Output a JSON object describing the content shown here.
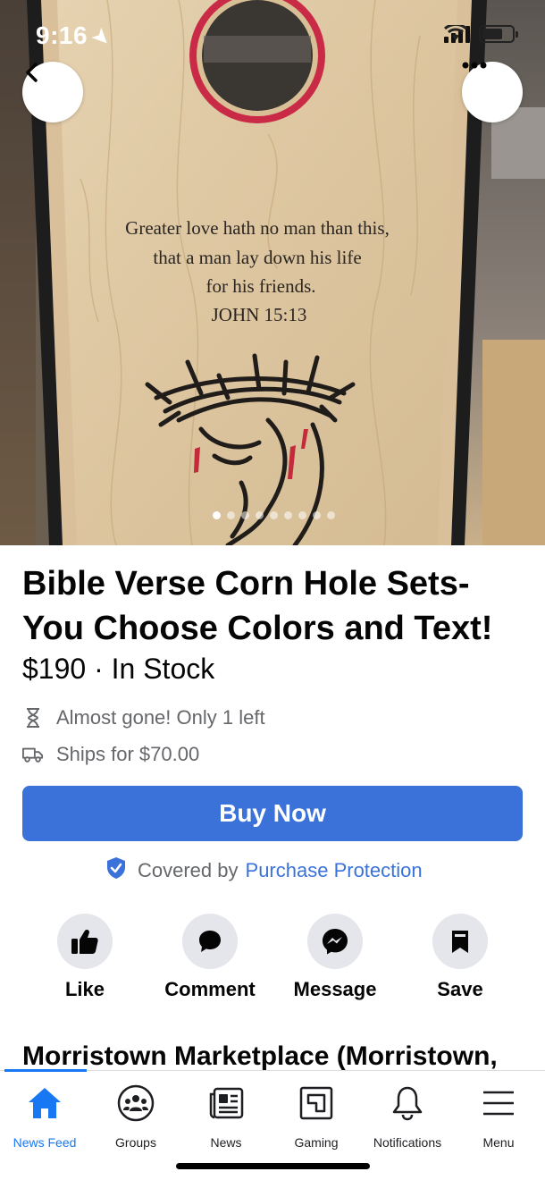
{
  "status_bar": {
    "time": "9:16",
    "icons": [
      "location-arrow-icon",
      "cellular-signal-icon",
      "wifi-icon",
      "battery-icon"
    ]
  },
  "photo": {
    "verse_lines": [
      "Greater love hath no man than this,",
      "that a man lay down his life",
      "for his friends.",
      "JOHN 15:13"
    ],
    "page_count": 9,
    "current_page": 1
  },
  "nav": {
    "back_icon": "chevron-left-icon",
    "more_icon": "more-horizontal-icon"
  },
  "listing": {
    "title_line1": "Bible Verse Corn Hole Sets-",
    "title_line2": "You Choose Colors and Text!",
    "price_line": "$190 · In Stock",
    "availability": "Almost gone! Only 1 left",
    "shipping": "Ships for $70.00"
  },
  "buy_button": {
    "label": "Buy Now"
  },
  "protection": {
    "prefix": "Covered by",
    "link": "Purchase Protection"
  },
  "actions": [
    {
      "label": "Like",
      "icon": "thumbs-up-icon"
    },
    {
      "label": "Comment",
      "icon": "comment-icon"
    },
    {
      "label": "Message",
      "icon": "messenger-icon"
    },
    {
      "label": "Save",
      "icon": "bookmark-icon"
    }
  ],
  "seller": {
    "name": "Morristown Marketplace (Morristown,"
  },
  "tabs": [
    {
      "label": "News Feed",
      "icon": "home-icon",
      "active": true
    },
    {
      "label": "Groups",
      "icon": "groups-icon",
      "active": false
    },
    {
      "label": "News",
      "icon": "news-icon",
      "active": false
    },
    {
      "label": "Gaming",
      "icon": "gaming-icon",
      "active": false
    },
    {
      "label": "Notifications",
      "icon": "bell-icon",
      "active": false
    },
    {
      "label": "Menu",
      "icon": "menu-icon",
      "active": false
    }
  ],
  "colors": {
    "accent": "#3b72d9",
    "tab_active": "#1877f2",
    "muted_text": "#65676b",
    "bubble_bg": "#e4e6eb"
  }
}
